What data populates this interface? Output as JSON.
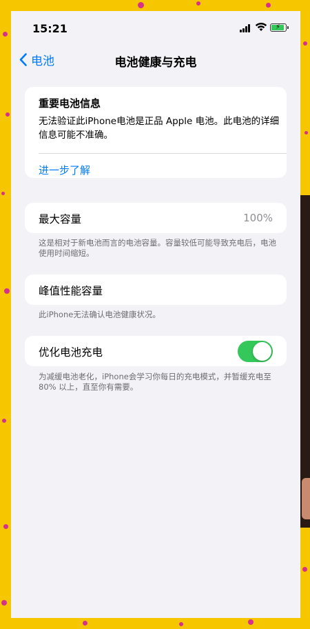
{
  "status_bar": {
    "time": "15:21"
  },
  "nav": {
    "back_label": "电池",
    "title": "电池健康与充电"
  },
  "info_card": {
    "heading": "重要电池信息",
    "body": "无法验证此iPhone电池是正品 Apple 电池。此电池的详细信息可能不准确。",
    "link": "进一步了解"
  },
  "max_capacity": {
    "label": "最大容量",
    "value": "100%",
    "footnote": "这是相对于新电池而言的电池容量。容量较低可能导致充电后，电池使用时间缩短。"
  },
  "peak_performance": {
    "label": "峰值性能容量",
    "footnote": "此iPhone无法确认电池健康状况。"
  },
  "optimized_charging": {
    "label": "优化电池充电",
    "enabled": true,
    "footnote": "为减缓电池老化，iPhone会学习你每日的充电模式，并暂缓充电至 80% 以上，直至你有需要。"
  },
  "colors": {
    "accent": "#007aff",
    "toggle_on": "#34c759",
    "background": "#f2f2f7",
    "frame": "#f6c600"
  }
}
